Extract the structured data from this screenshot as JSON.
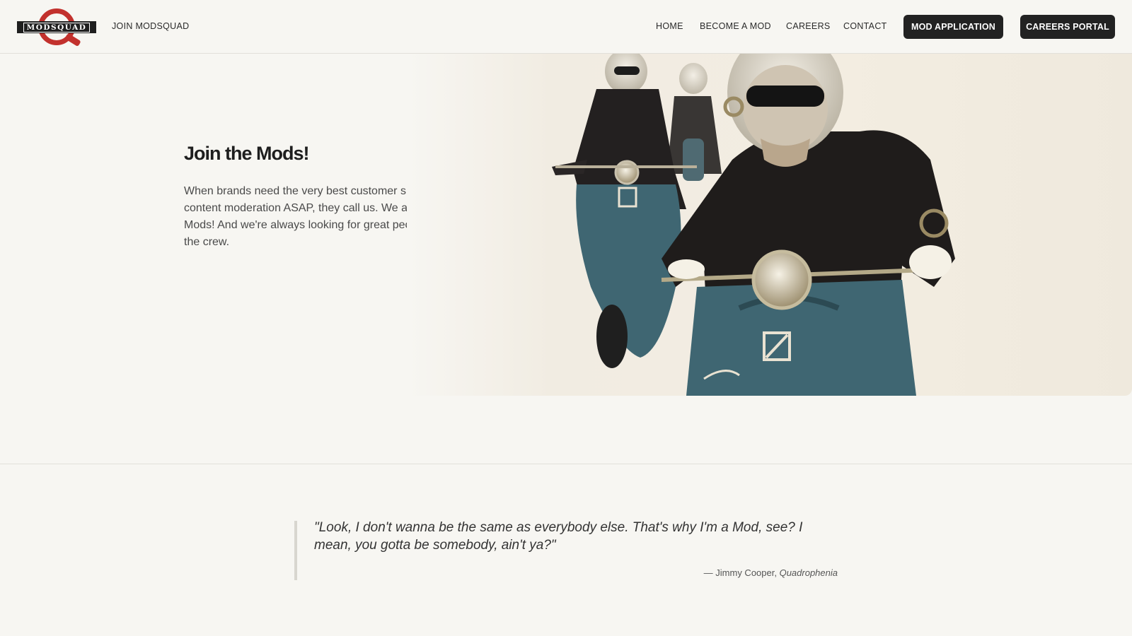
{
  "header": {
    "logo_text": "MODSQUAD",
    "join_link": "JOIN MODSQUAD",
    "nav": {
      "home": "HOME",
      "become": "BECOME A MOD",
      "careers": "CAREERS",
      "contact": "CONTACT"
    },
    "buttons": {
      "mod_application": "MOD APPLICATION",
      "careers_portal": "CAREERS PORTAL"
    }
  },
  "hero": {
    "title": "Join the Mods!",
    "body": "When brands need the very best customer support and content moderation ASAP, they call us. We are the Mods! And we're always looking for great people to join the crew."
  },
  "quote": {
    "text": "\"Look, I don't wanna be the same as everybody else. That's why I'm a Mod, see? I mean, you gotta be somebody, ain't ya?\"",
    "author": "— Jimmy Cooper,",
    "source": "Quadrophenia"
  },
  "colors": {
    "background": "#f7f6f2",
    "brand_red": "#c2312d",
    "button_dark": "#222222",
    "scooter_teal": "#3f6672"
  }
}
